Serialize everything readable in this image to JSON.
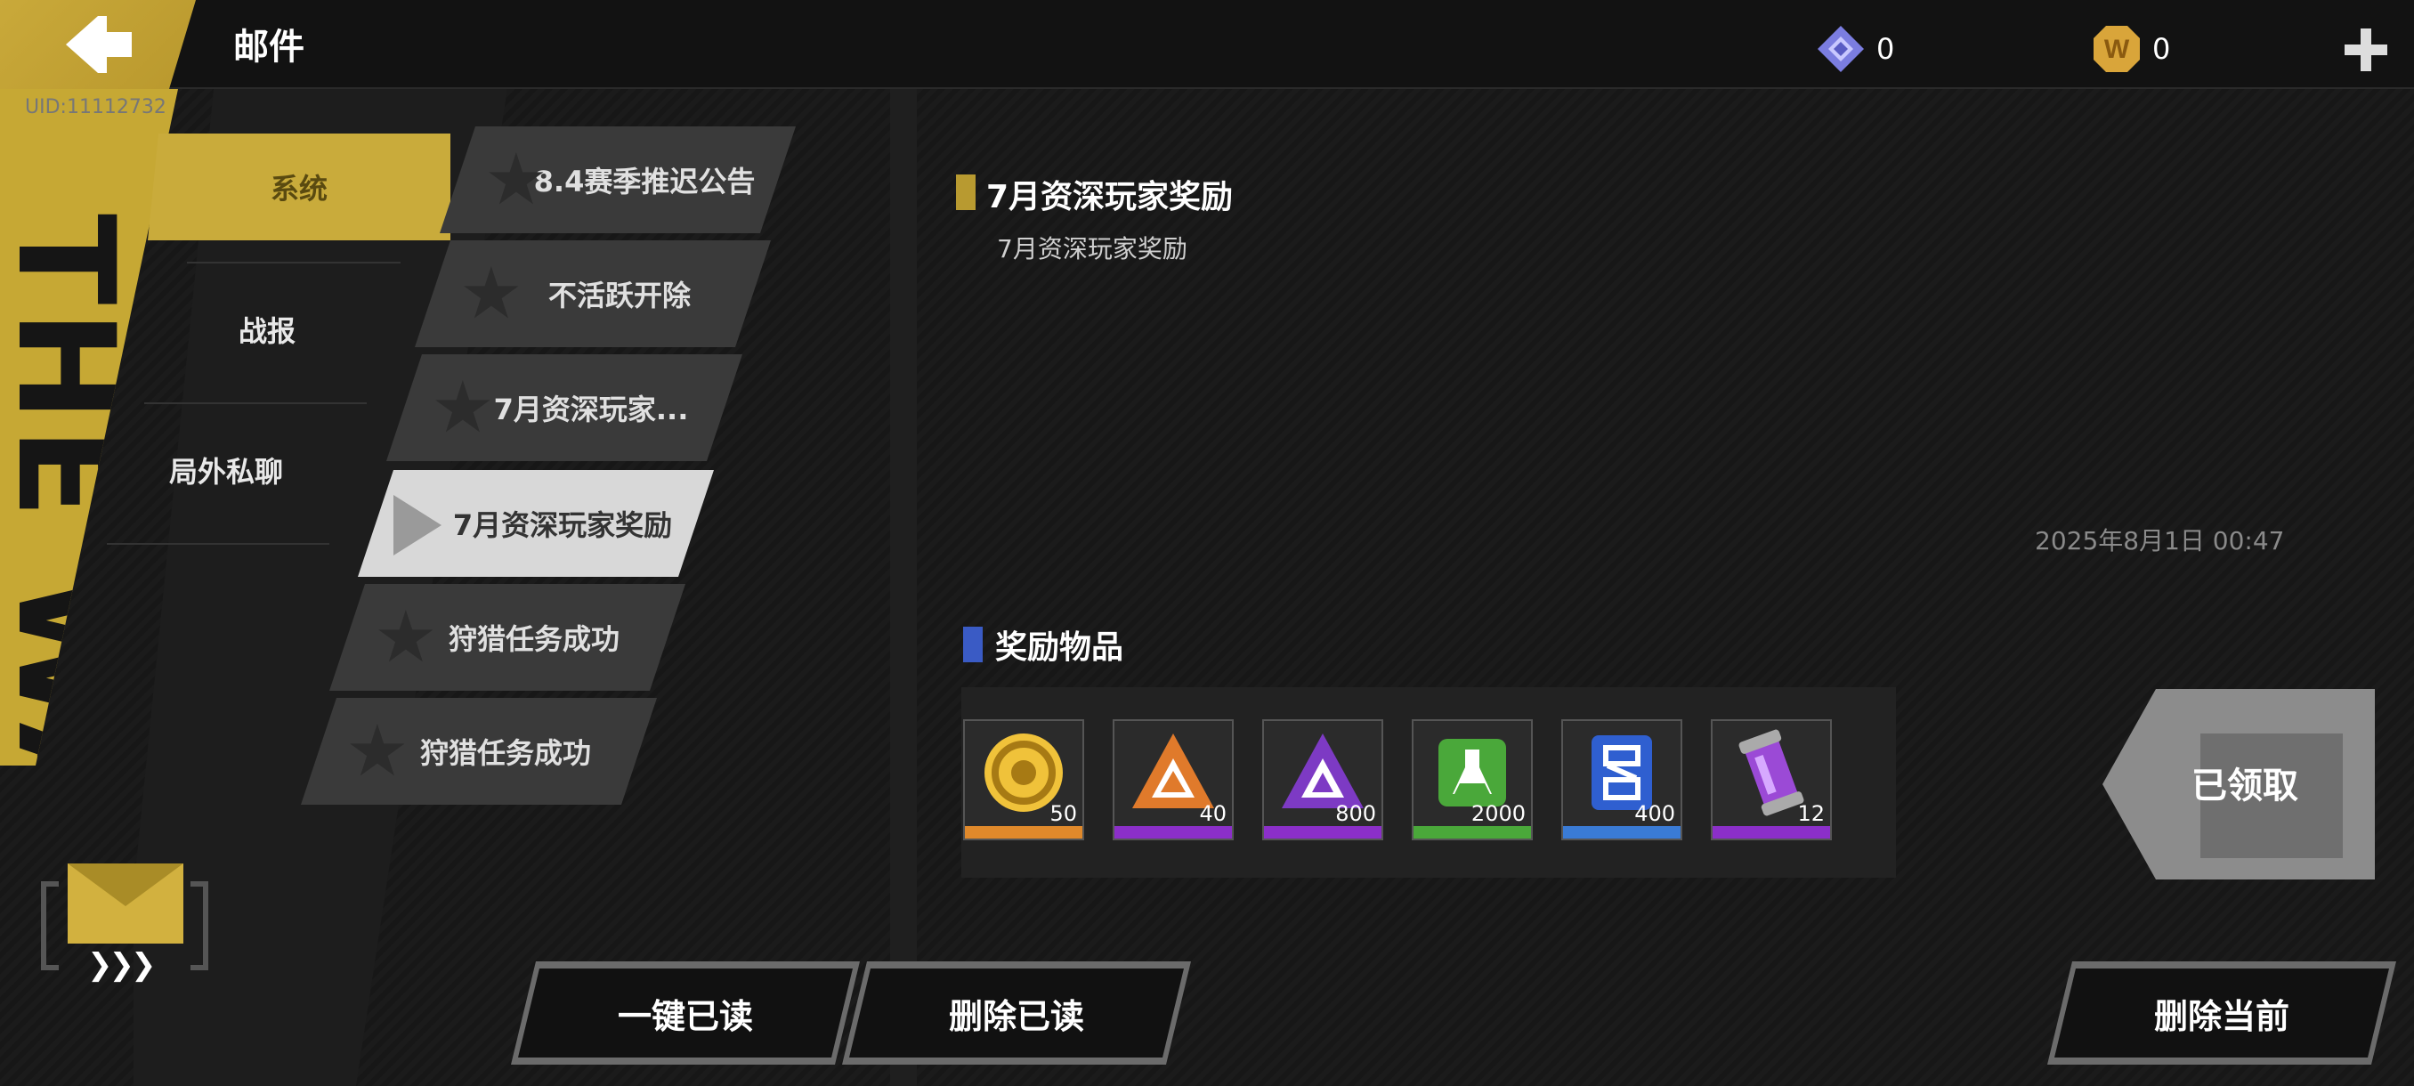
{
  "header": {
    "title": "邮件",
    "uid": "UID:11112732",
    "currency_gem_value": "0",
    "currency_coin_value": "0",
    "coin_letter": "W"
  },
  "decoration": {
    "vertical_text": "THE WAR"
  },
  "categories": [
    {
      "label": "系统",
      "active": true
    },
    {
      "label": "战报",
      "active": false
    },
    {
      "label": "局外私聊",
      "active": false
    }
  ],
  "mail_list": [
    {
      "label": "8.4赛季推迟公告"
    },
    {
      "label": "不活跃开除"
    },
    {
      "label": "7月资深玩家..."
    },
    {
      "label": "7月资深玩家奖励",
      "selected": true
    },
    {
      "label": "狩猎任务成功"
    },
    {
      "label": "狩猎任务成功"
    }
  ],
  "mail": {
    "title": "7月资深玩家奖励",
    "body": "7月资深玩家奖励",
    "date": "2025年8月1日  00:47"
  },
  "rewards": {
    "title": "奖励物品",
    "items": [
      {
        "icon": "gold-coin-icon",
        "count": "50",
        "rarity_color": "#e0892b"
      },
      {
        "icon": "orange-triangle-icon",
        "count": "40",
        "rarity_color": "#8b2fc9"
      },
      {
        "icon": "purple-triangle-icon",
        "count": "800",
        "rarity_color": "#8b2fc9"
      },
      {
        "icon": "green-flask-icon",
        "count": "2000",
        "rarity_color": "#4aa83a"
      },
      {
        "icon": "blue-dna-icon",
        "count": "400",
        "rarity_color": "#3a7bd5"
      },
      {
        "icon": "purple-canister-icon",
        "count": "12",
        "rarity_color": "#8b2fc9"
      }
    ],
    "claimed_label": "已领取"
  },
  "buttons": {
    "read_all": "一键已读",
    "delete_read": "删除已读",
    "delete_current": "删除当前"
  }
}
